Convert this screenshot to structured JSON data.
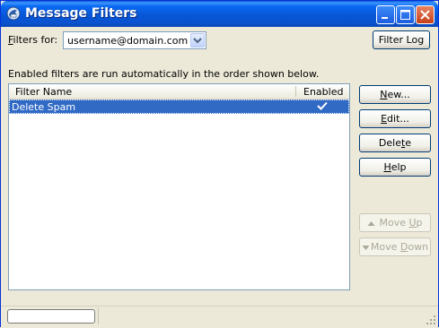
{
  "window": {
    "title": "Message Filters"
  },
  "filters_for": {
    "label_prefix": "",
    "label_mnemonic": "F",
    "label_rest": "ilters for:",
    "selected_account": "username@domain.com"
  },
  "buttons": {
    "filter_log": "Filter Log",
    "new_mnemonic": "N",
    "new_rest": "ew...",
    "edit_mnemonic": "E",
    "edit_rest": "dit...",
    "delete_pre": "Dele",
    "delete_mnemonic": "t",
    "delete_post": "e",
    "help_mnemonic": "H",
    "help_rest": "elp",
    "move_up_pre": "Move ",
    "move_up_mnemonic": "U",
    "move_up_post": "p",
    "move_down_pre": "Move ",
    "move_down_mnemonic": "D",
    "move_down_post": "own"
  },
  "info_text": "Enabled filters are run automatically in the order shown below.",
  "table": {
    "columns": [
      "Filter Name",
      "Enabled"
    ],
    "rows": [
      {
        "name": "Delete Spam",
        "enabled": true
      }
    ]
  },
  "icons": {
    "app": "thunderbird-icon",
    "minimize": "minimize-icon",
    "maximize": "maximize-icon",
    "close": "close-icon",
    "dropdown": "chevron-down-icon",
    "check": "check-icon",
    "move_up": "triangle-up-icon",
    "move_down": "triangle-down-icon",
    "grip": "resize-grip-icon"
  },
  "colors": {
    "titlebar": "#0a5fd8",
    "selection": "#316ac5",
    "face": "#ece9d8",
    "close_button": "#c6401b"
  }
}
